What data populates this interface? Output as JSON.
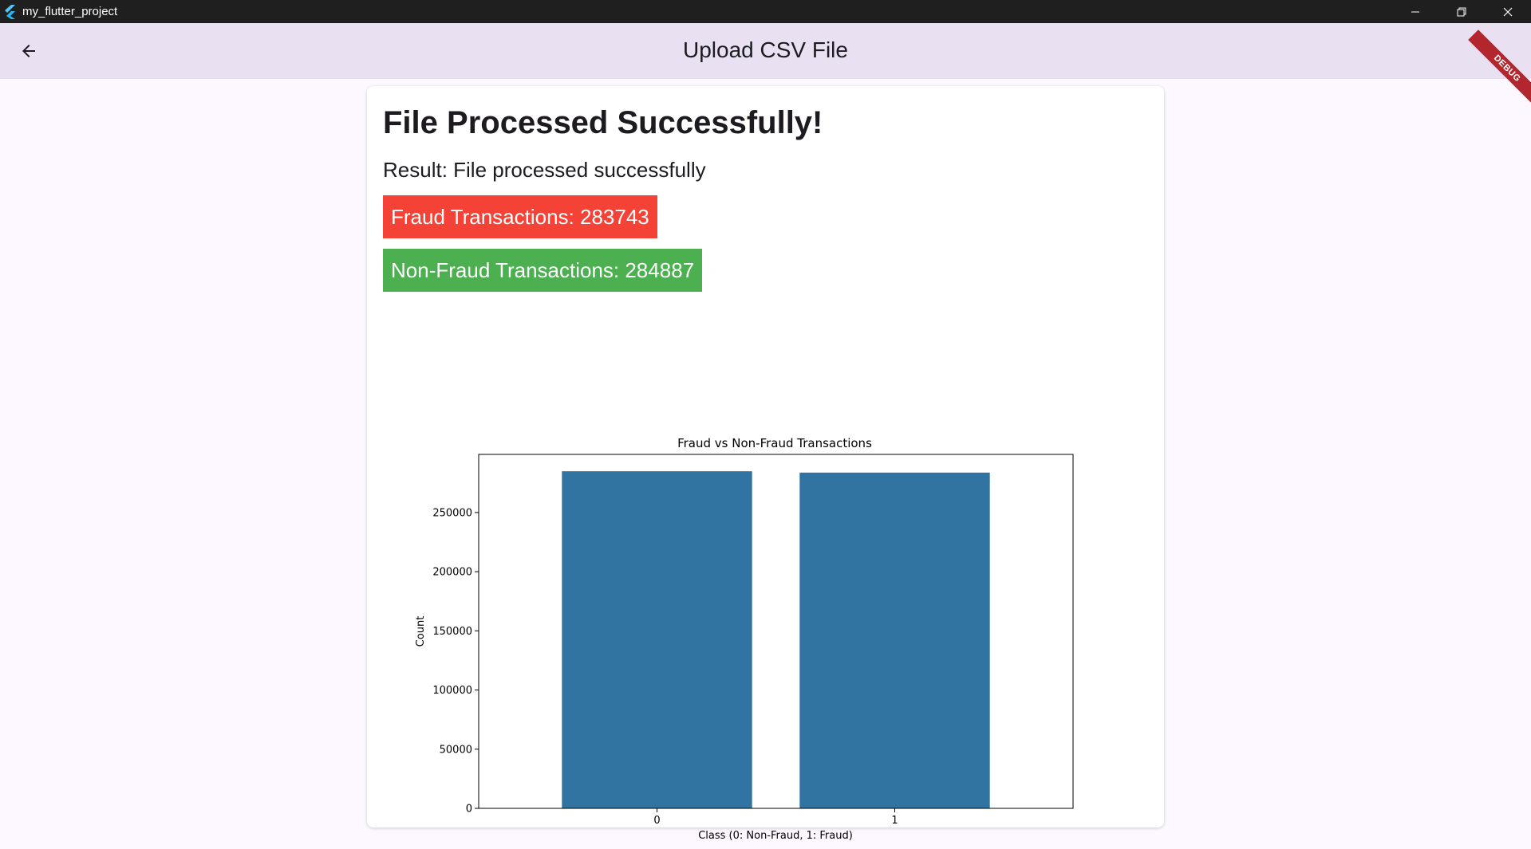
{
  "window": {
    "title": "my_flutter_project",
    "minimize_icon": "minimize-icon",
    "restore_icon": "restore-icon",
    "close_icon": "close-icon"
  },
  "appbar": {
    "title": "Upload CSV File",
    "back_icon": "arrow-left-icon",
    "debug_label": "DEBUG"
  },
  "result_card": {
    "heading": "File Processed Successfully!",
    "result_text": "Result: File processed successfully",
    "fraud_label": "Fraud Transactions: 283743",
    "nonfraud_label": "Non-Fraud Transactions: 284887",
    "fraud_color": "#f44336",
    "nonfraud_color": "#4caf50"
  },
  "chart_data": {
    "type": "bar",
    "title": "Fraud vs Non-Fraud Transactions",
    "xlabel": "Class (0: Non-Fraud, 1: Fraud)",
    "ylabel": "Count",
    "categories": [
      "0",
      "1"
    ],
    "values": [
      284887,
      283743
    ],
    "yticks": [
      "0",
      "50000",
      "100000",
      "150000",
      "200000",
      "250000"
    ],
    "ylim": [
      0,
      299131
    ],
    "bar_color": "#3274a1",
    "grid": false,
    "legend": false
  }
}
